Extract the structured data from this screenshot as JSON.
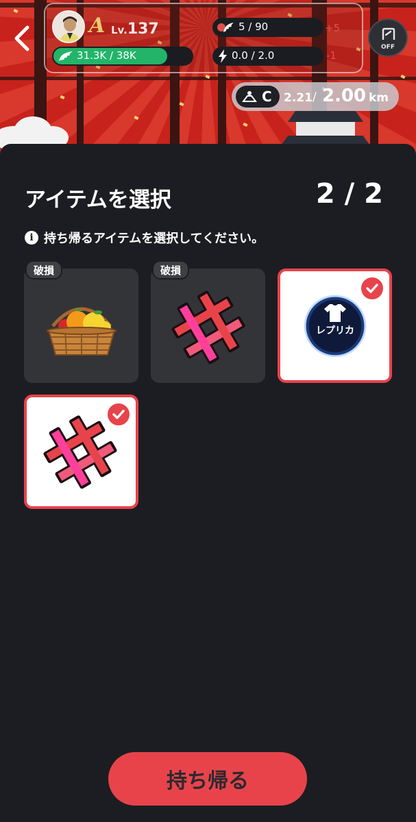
{
  "hud": {
    "rank": "A",
    "level_prefix": "Lv.",
    "level": "137",
    "energy_text": "31.3K / 38K",
    "energy_fraction": 0.82,
    "stamina_text": "5 / 90",
    "stamina_delta": "+5",
    "speed_text": "0.0 / 2.0",
    "speed_delta": "-1",
    "toggle_label": "OFF",
    "grade": "C",
    "distance_current": "2.21",
    "distance_separator": "/",
    "distance_goal": "2.00",
    "distance_unit": "km"
  },
  "sheet": {
    "title": "アイテムを選択",
    "count": "2 / 2",
    "info": "持ち帰るアイテムを選択してください。",
    "info_icon": "i",
    "items": [
      {
        "name": "fruit-basket",
        "tag": "破損",
        "selected": false
      },
      {
        "name": "hashtag",
        "tag": "破損",
        "selected": false
      },
      {
        "name": "replica-shirt",
        "tag": "",
        "label": "レプリカ",
        "selected": true
      },
      {
        "name": "hashtag",
        "tag": "",
        "selected": true
      }
    ],
    "cta": "持ち帰る"
  },
  "colors": {
    "accent": "#e8434b",
    "energy": "#23b46a",
    "sheet_bg": "#1c1d22",
    "card_bg": "#333438"
  }
}
